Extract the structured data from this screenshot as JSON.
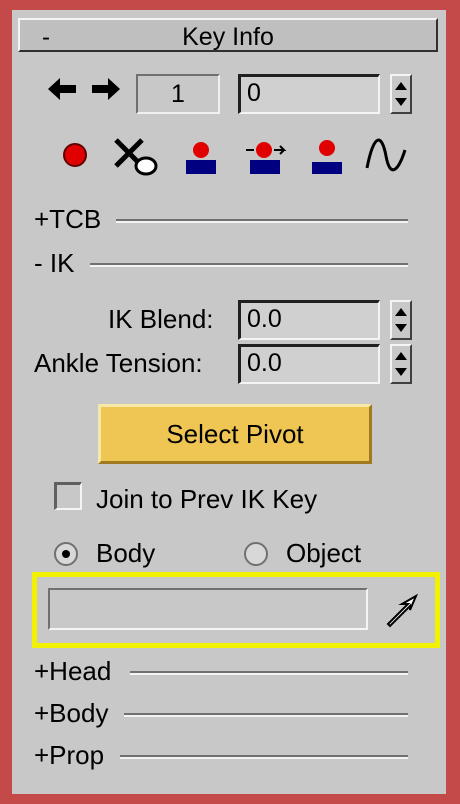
{
  "panel": {
    "title_toggle": "-",
    "title": "Key Info"
  },
  "key_nav": {
    "prev_icon": "arrow-left-icon",
    "next_icon": "arrow-right-icon",
    "key_index": "1",
    "time_value": "0"
  },
  "toolbar_icons": [
    "set-key-icon",
    "delete-key-icon",
    "set-planted-key-icon",
    "set-sliding-key-icon",
    "set-free-key-icon",
    "curve-icon"
  ],
  "sections_top": [
    {
      "label": "+TCB"
    },
    {
      "label": "- IK"
    }
  ],
  "ik": {
    "blend_label": "IK Blend:",
    "blend_value": "0.0",
    "ankle_label": "Ankle Tension:",
    "ankle_value": "0.0",
    "select_pivot": "Select Pivot",
    "join_label": "Join to Prev IK Key",
    "join_checked": false,
    "radio_body": "Body",
    "radio_object": "Object",
    "selected": "Body",
    "object_field": "",
    "pick_icon": "pick-arrow-icon"
  },
  "sections_bottom": [
    {
      "label": "+Head"
    },
    {
      "label": "+Body"
    },
    {
      "label": "+Prop"
    }
  ],
  "colors": {
    "frame_border": "#c44a4a",
    "highlight": "#f2f200",
    "pivot_button": "#efc654",
    "key_red": "#e00000",
    "key_blue": "#000080"
  }
}
